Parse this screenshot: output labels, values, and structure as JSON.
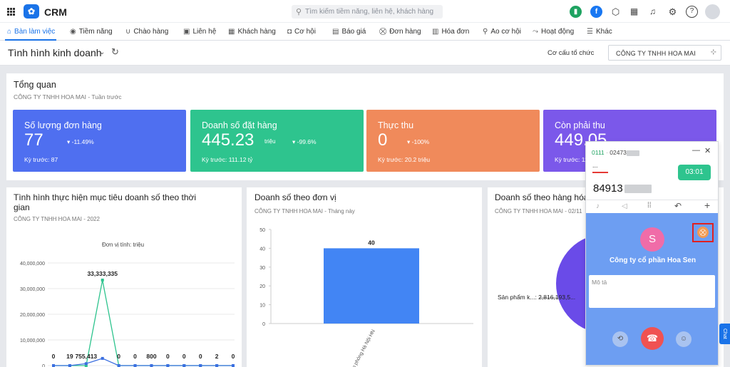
{
  "app": {
    "brand": "CRM",
    "logo_glyph": "✿"
  },
  "search": {
    "placeholder": "Tìm kiếm tiềm năng, liên hệ, khách hàng"
  },
  "nav": [
    {
      "label": "Bàn làm việc",
      "icon": "home-icon",
      "glyph": "⌂"
    },
    {
      "label": "Tiềm năng",
      "icon": "person-circle-icon",
      "glyph": "◉"
    },
    {
      "label": "Chào hàng",
      "icon": "magnet-icon",
      "glyph": "∪"
    },
    {
      "label": "Liên hệ",
      "icon": "contact-card-icon",
      "glyph": "▣"
    },
    {
      "label": "Khách hàng",
      "icon": "building-icon",
      "glyph": "▦"
    },
    {
      "label": "Cơ hội",
      "icon": "briefcase-icon",
      "glyph": "◘"
    },
    {
      "label": "Báo giá",
      "icon": "document-icon",
      "glyph": "▤"
    },
    {
      "label": "Đơn hàng",
      "icon": "cart-icon",
      "glyph": "⛒"
    },
    {
      "label": "Hóa đơn",
      "icon": "invoice-icon",
      "glyph": "▥"
    },
    {
      "label": "Ao cơ hội",
      "icon": "pool-icon",
      "glyph": "⚲"
    },
    {
      "label": "Hoạt động",
      "icon": "activity-icon",
      "glyph": "⤳"
    },
    {
      "label": "Khác",
      "icon": "menu-icon",
      "glyph": "☰"
    }
  ],
  "page": {
    "title": "Tình hình kinh doanh",
    "org_label": "Cơ cấu tổ chức",
    "org_value": "CÔNG TY TNHH HOA MAI"
  },
  "overview": {
    "title": "Tổng quan",
    "subtitle": "CÔNG TY TNHH HOA MAI - Tuần trước",
    "kpis": [
      {
        "label": "Số lượng đơn hàng",
        "value": "77",
        "unit": "",
        "change": "-11.49%",
        "prev": "Kỳ trước: 87",
        "color": "#4f6ff0"
      },
      {
        "label": "Doanh số đặt hàng",
        "value": "445.23",
        "unit": "triệu",
        "change": "-99.6%",
        "prev": "Kỳ trước: 111.12 tỷ",
        "color": "#2ec48e"
      },
      {
        "label": "Thực thu",
        "value": "0",
        "unit": "",
        "change": "-100%",
        "prev": "Kỳ trước: 20.2 triệu",
        "color": "#f08a5b"
      },
      {
        "label": "Còn phải thu",
        "value": "449.05",
        "unit": "",
        "change": "",
        "prev": "Kỳ trước: 11",
        "color": "#7b58ea"
      }
    ]
  },
  "chart1": {
    "title": "Tình hình thực hiện mục tiêu doanh số theo thời gian",
    "subtitle": "CÔNG TY TNHH HOA MAI - 2022",
    "unit_note": "Đơn vị tính: triệu"
  },
  "chart2": {
    "title": "Doanh số theo đơn vị",
    "subtitle": "CÔNG TY TNHH HOA MAI - Tháng này"
  },
  "chart3": {
    "title": "Doanh số theo hàng hóa",
    "subtitle": "CÔNG TY TNHH HOA MAI - 02/11",
    "slice_label": "Sản phẩm k...: 2,816,193,5..."
  },
  "chart_data": [
    {
      "type": "line",
      "ylim": [
        0,
        40000000
      ],
      "yticks": [
        "0",
        "10,000,000",
        "20,000,000",
        "30,000,000",
        "40,000,000"
      ],
      "series": [
        {
          "values": [
            0,
            0,
            0,
            33333335,
            0,
            0,
            0,
            0,
            0,
            0,
            0,
            0
          ],
          "color": "#2ec48e"
        },
        {
          "values": [
            0,
            19,
            755413,
            2800000,
            0,
            0,
            800,
            0,
            0,
            0,
            2,
            0
          ],
          "color": "#3b6fe0"
        }
      ],
      "data_labels": [
        "0",
        "19",
        "755,413",
        "33,333,335",
        "0",
        "0",
        "800",
        "0",
        "0",
        "0",
        "2",
        "0"
      ]
    },
    {
      "type": "bar",
      "categories": [
        "Văn phòng Hà Nội HN"
      ],
      "values": [
        40
      ],
      "ylim": [
        0,
        50
      ],
      "yticks": [
        "0",
        "10",
        "20",
        "30",
        "40",
        "50"
      ],
      "color": "#4285f4"
    }
  ],
  "call": {
    "line": "0111",
    "dot": "·",
    "number_partial": "02473",
    "caller_partial": "84913",
    "timer": "03:01",
    "dots": "...",
    "avatar_letter": "S",
    "company": "Công ty cổ phần Hoa Sen",
    "note_placeholder": "Mô tả"
  },
  "chat": {
    "label": "Chat"
  }
}
